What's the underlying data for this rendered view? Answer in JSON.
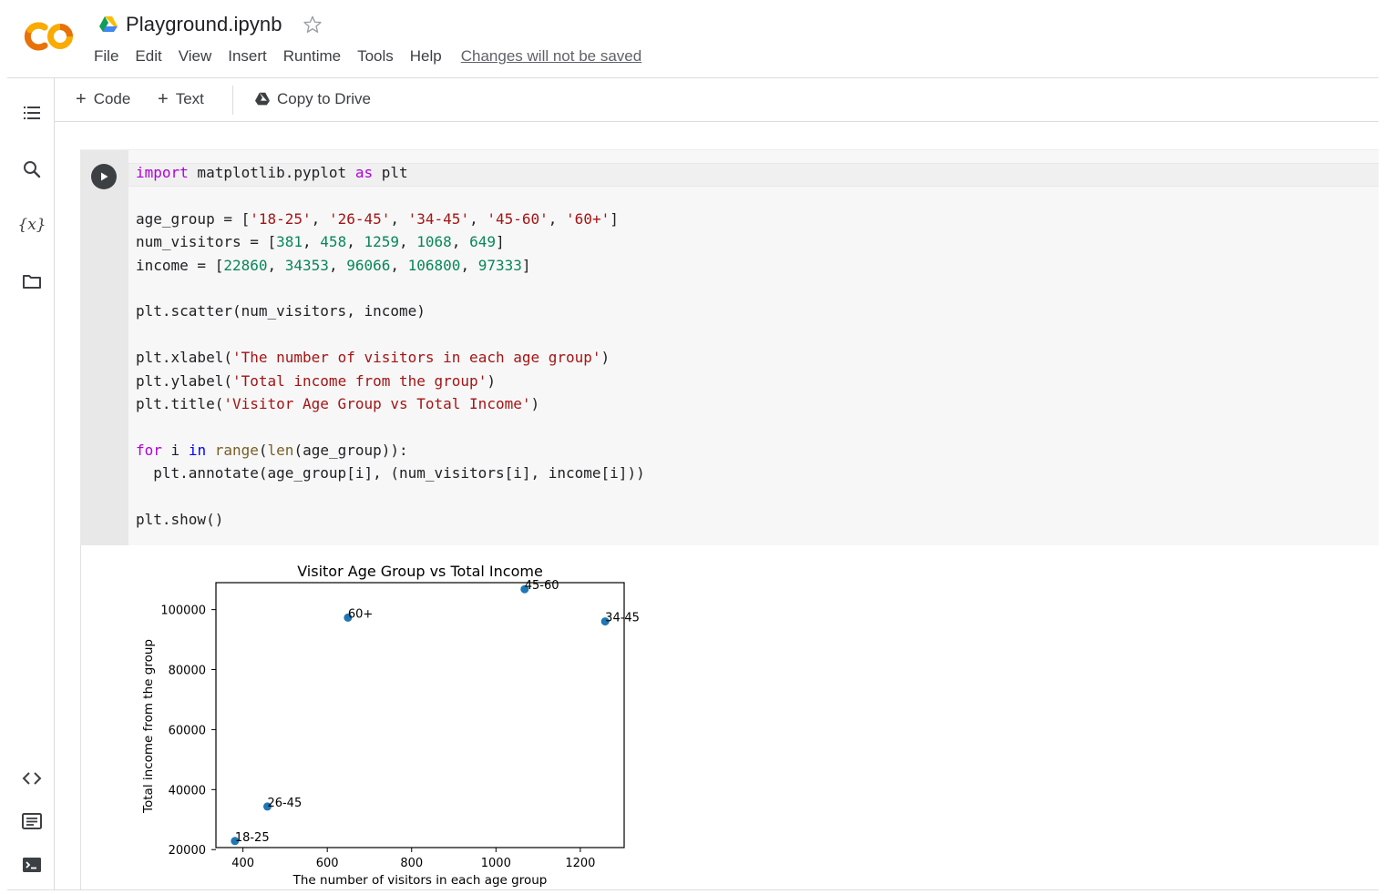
{
  "app": {
    "doc_title": "Playground.ipynb",
    "menu": [
      "File",
      "Edit",
      "View",
      "Insert",
      "Runtime",
      "Tools",
      "Help"
    ],
    "changes_notice": "Changes will not be saved",
    "logo_color_a": "#F9AB00",
    "logo_color_b": "#E8710A",
    "drive_icon": "google-drive-icon",
    "star_icon": "star-outline-icon"
  },
  "toolbar": {
    "code_label": "Code",
    "text_label": "Text",
    "copy_label": "Copy to Drive"
  },
  "rail": {
    "icons": [
      "table-of-contents-icon",
      "search-icon",
      "variables-icon",
      "files-icon",
      "code-snippets-icon",
      "command-palette-icon",
      "terminal-icon"
    ],
    "variables_glyph": "{x}"
  },
  "cell": {
    "lines": [
      [
        [
          "kw",
          "import"
        ],
        [
          "",
          " matplotlib.pyplot "
        ],
        [
          "kw",
          "as"
        ],
        [
          "",
          " plt"
        ]
      ],
      [],
      [
        [
          "",
          "age_group = ["
        ],
        [
          "str",
          "'18-25'"
        ],
        [
          "",
          ", "
        ],
        [
          "str",
          "'26-45'"
        ],
        [
          "",
          ", "
        ],
        [
          "str",
          "'34-45'"
        ],
        [
          "",
          ", "
        ],
        [
          "str",
          "'45-60'"
        ],
        [
          "",
          ", "
        ],
        [
          "str",
          "'60+'"
        ],
        [
          "",
          "]"
        ]
      ],
      [
        [
          "",
          "num_visitors = ["
        ],
        [
          "num",
          "381"
        ],
        [
          "",
          ", "
        ],
        [
          "num",
          "458"
        ],
        [
          "",
          ", "
        ],
        [
          "num",
          "1259"
        ],
        [
          "",
          ", "
        ],
        [
          "num",
          "1068"
        ],
        [
          "",
          ", "
        ],
        [
          "num",
          "649"
        ],
        [
          "",
          "]"
        ]
      ],
      [
        [
          "",
          "income = ["
        ],
        [
          "num",
          "22860"
        ],
        [
          "",
          ", "
        ],
        [
          "num",
          "34353"
        ],
        [
          "",
          ", "
        ],
        [
          "num",
          "96066"
        ],
        [
          "",
          ", "
        ],
        [
          "num",
          "106800"
        ],
        [
          "",
          ", "
        ],
        [
          "num",
          "97333"
        ],
        [
          "",
          "]"
        ]
      ],
      [],
      [
        [
          "",
          "plt.scatter(num_visitors, income)"
        ]
      ],
      [],
      [
        [
          "",
          "plt.xlabel("
        ],
        [
          "str",
          "'The number of visitors in each age group'"
        ],
        [
          "",
          ")"
        ]
      ],
      [
        [
          "",
          "plt.ylabel("
        ],
        [
          "str",
          "'Total income from the group'"
        ],
        [
          "",
          ")"
        ]
      ],
      [
        [
          "",
          "plt.title("
        ],
        [
          "str",
          "'Visitor Age Group vs Total Income'"
        ],
        [
          "",
          ")"
        ]
      ],
      [],
      [
        [
          "kw",
          "for"
        ],
        [
          "",
          " i "
        ],
        [
          "kw2",
          "in"
        ],
        [
          "",
          " "
        ],
        [
          "fn",
          "range"
        ],
        [
          "",
          "("
        ],
        [
          "fn",
          "len"
        ],
        [
          "",
          "(age_group)):"
        ]
      ],
      [
        [
          "",
          "  plt.annotate(age_group[i], (num_visitors[i], income[i]))"
        ]
      ],
      [],
      [
        [
          "",
          "plt.show()"
        ]
      ]
    ]
  },
  "chart_data": {
    "type": "scatter",
    "title": "Visitor Age Group vs Total Income",
    "xlabel": "The number of visitors in each age group",
    "ylabel": "Total income from the group",
    "x": [
      381,
      458,
      1259,
      1068,
      649
    ],
    "y": [
      22860,
      34353,
      96066,
      106800,
      97333
    ],
    "labels": [
      "18-25",
      "26-45",
      "34-45",
      "45-60",
      "60+"
    ],
    "xlim": [
      336,
      1304
    ],
    "ylim": [
      20673,
      108987
    ],
    "xticks": [
      400,
      600,
      800,
      1000,
      1200
    ],
    "yticks": [
      20000,
      40000,
      60000,
      80000,
      100000
    ],
    "point_color": "#1f77b4",
    "grid": false
  }
}
